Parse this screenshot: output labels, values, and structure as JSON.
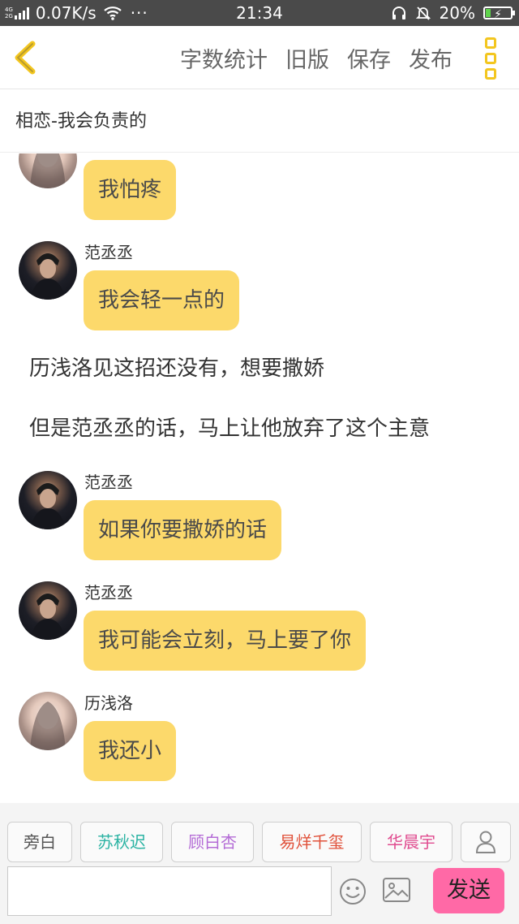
{
  "status_bar": {
    "network_top": "4G",
    "network_bottom": "2G",
    "speed": "0.07K/s",
    "more": "···",
    "time": "21:34",
    "battery": "20%",
    "battery_level": 0.2
  },
  "header": {
    "actions": [
      "字数统计",
      "旧版",
      "保存",
      "发布"
    ]
  },
  "title": "相恋-我会负责的",
  "messages": [
    {
      "type": "bubble",
      "avatar": "girl",
      "name": "",
      "text": "我怕疼"
    },
    {
      "type": "bubble",
      "avatar": "boy",
      "name": "范丞丞",
      "text": "我会轻一点的"
    },
    {
      "type": "narration",
      "text": "历浅洛见这招还没有，想要撒娇"
    },
    {
      "type": "narration",
      "text": "但是范丞丞的话，马上让他放弃了这个主意"
    },
    {
      "type": "bubble",
      "avatar": "boy",
      "name": "范丞丞",
      "text": "如果你要撒娇的话"
    },
    {
      "type": "bubble",
      "avatar": "boy",
      "name": "范丞丞",
      "text": "我可能会立刻，马上要了你"
    },
    {
      "type": "bubble",
      "avatar": "girl",
      "name": "历浅洛",
      "text": "我还小"
    }
  ],
  "characters": [
    {
      "label": "旁白",
      "color": "#555555"
    },
    {
      "label": "苏秋迟",
      "color": "#2bb3a3"
    },
    {
      "label": "顾白杏",
      "color": "#b46cd6"
    },
    {
      "label": "易烊千玺",
      "color": "#e0513a"
    },
    {
      "label": "华晨宇",
      "color": "#e04b8f"
    }
  ],
  "composer": {
    "input_value": "",
    "send_label": "发送"
  },
  "colors": {
    "accent": "#f3c61f",
    "bubble": "#fcd96b",
    "send": "#ff69a6"
  }
}
